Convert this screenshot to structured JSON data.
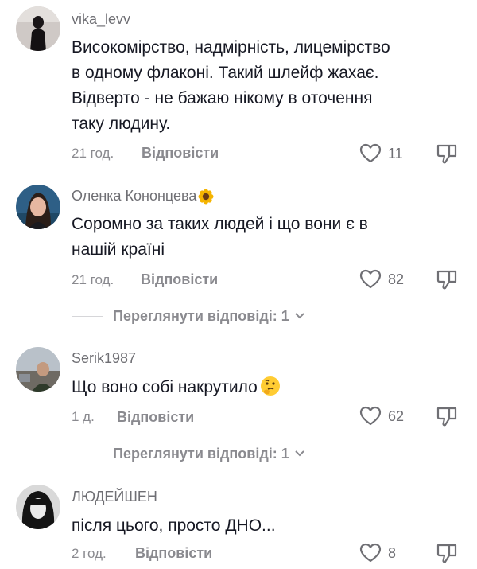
{
  "comments": [
    {
      "username": "vika_levv",
      "text_lines": [
        "Високомірство, надмірність, лицемірство",
        "в одному флаконі. Такий шлейф жахає.",
        "Відверто - не бажаю нікому в оточення",
        "таку людину."
      ],
      "time": "21 год.",
      "reply_label": "Відповісти",
      "likes": "11"
    },
    {
      "username": "Оленка Кононцева",
      "username_emoji": "sunflower",
      "text_lines": [
        "Соромно за таких людей і що вони є в",
        "нашій країні"
      ],
      "time": "21 год.",
      "reply_label": "Відповісти",
      "likes": "82",
      "view_replies": "Переглянути відповіді: 1"
    },
    {
      "username": "Serik1987",
      "text_lines": [
        "Що воно собі накрутило"
      ],
      "text_emoji": "thinking-face",
      "time": "1 д.",
      "reply_label": "Відповісти",
      "likes": "62",
      "view_replies": "Переглянути відповіді: 1"
    },
    {
      "username": "ЛЮДЕЙШЕН",
      "text_lines": [
        "після цього, просто ДНО..."
      ],
      "time": "2 год.",
      "reply_label": "Відповісти",
      "likes": "8"
    }
  ],
  "icons": {
    "like": "heart-outline-icon",
    "dislike": "thumbs-down-outline-icon",
    "expand": "chevron-down-icon"
  },
  "colors": {
    "text": "#161823",
    "secondary": "#8a8a8f",
    "background": "#ffffff"
  }
}
